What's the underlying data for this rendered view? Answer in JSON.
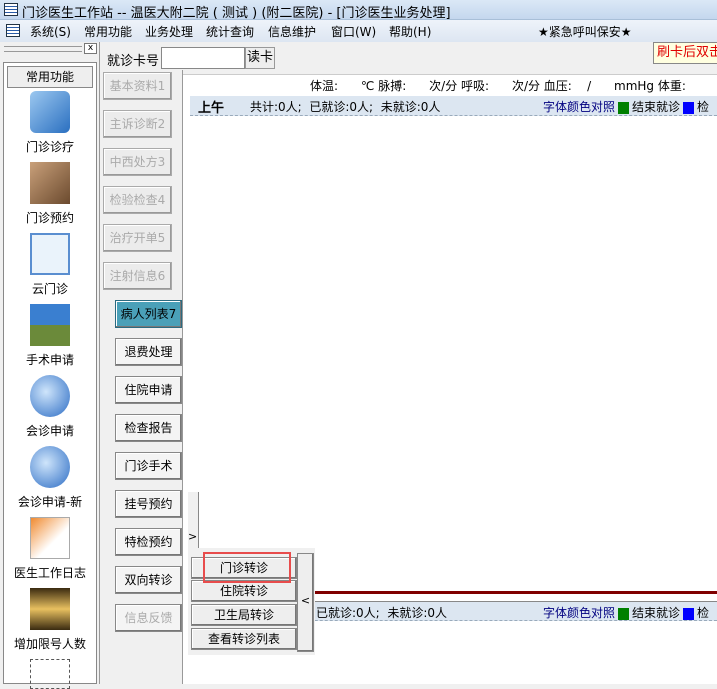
{
  "title": "门诊医生工作站 -- 温医大附二院 ( 测试 ) (附二医院) - [门诊医生业务处理]",
  "menu": [
    "系统(S)",
    "常用功能",
    "业务处理",
    "统计查询",
    "信息维护",
    "窗口(W)",
    "帮助(H)"
  ],
  "alert": "★紧急呼叫保安★",
  "left": {
    "close": "x",
    "header": "常用功能",
    "items": [
      "门诊诊疗",
      "门诊预约",
      "云门诊",
      "手术申请",
      "会诊申请",
      "会诊申请-新",
      "医生工作日志",
      "增加限号人数"
    ]
  },
  "card": {
    "label": "就诊卡号",
    "value": "",
    "read": "读卡",
    "hint": "刷卡后双击"
  },
  "tabs": [
    "基本资料1",
    "主诉诊断2",
    "中西处方3",
    "检验检查4",
    "治疗开单5",
    "注射信息6"
  ],
  "actions": [
    "病人列表7",
    "退费处理",
    "住院申请",
    "检查报告",
    "门诊手术",
    "挂号预约",
    "特检预约",
    "双向转诊",
    "信息反馈"
  ],
  "vitals": "体温:      ℃ 脉搏:      次/分 呼吸:      次/分 血压:    /      mmHg 体重:",
  "morning": {
    "label": "上午",
    "stats": "共计:0人;  已就诊:0人;  未就诊:0人",
    "legend": "字体颜色对照",
    "done": "结束就诊",
    "check": "检"
  },
  "afternoon": {
    "stats": "已就诊:0人;  未就诊:0人",
    "legend": "字体颜色对照",
    "done": "结束就诊",
    "check": "检"
  },
  "popup": {
    "items": [
      "门诊转诊",
      "住院转诊",
      "卫生局转诊",
      "查看转诊列表"
    ],
    "expand": ">",
    "collapse": "<"
  },
  "colors": {
    "done": "#008000",
    "check": "#0000ff",
    "highlight": "#e84c4c",
    "active": "#4aa0b8"
  }
}
